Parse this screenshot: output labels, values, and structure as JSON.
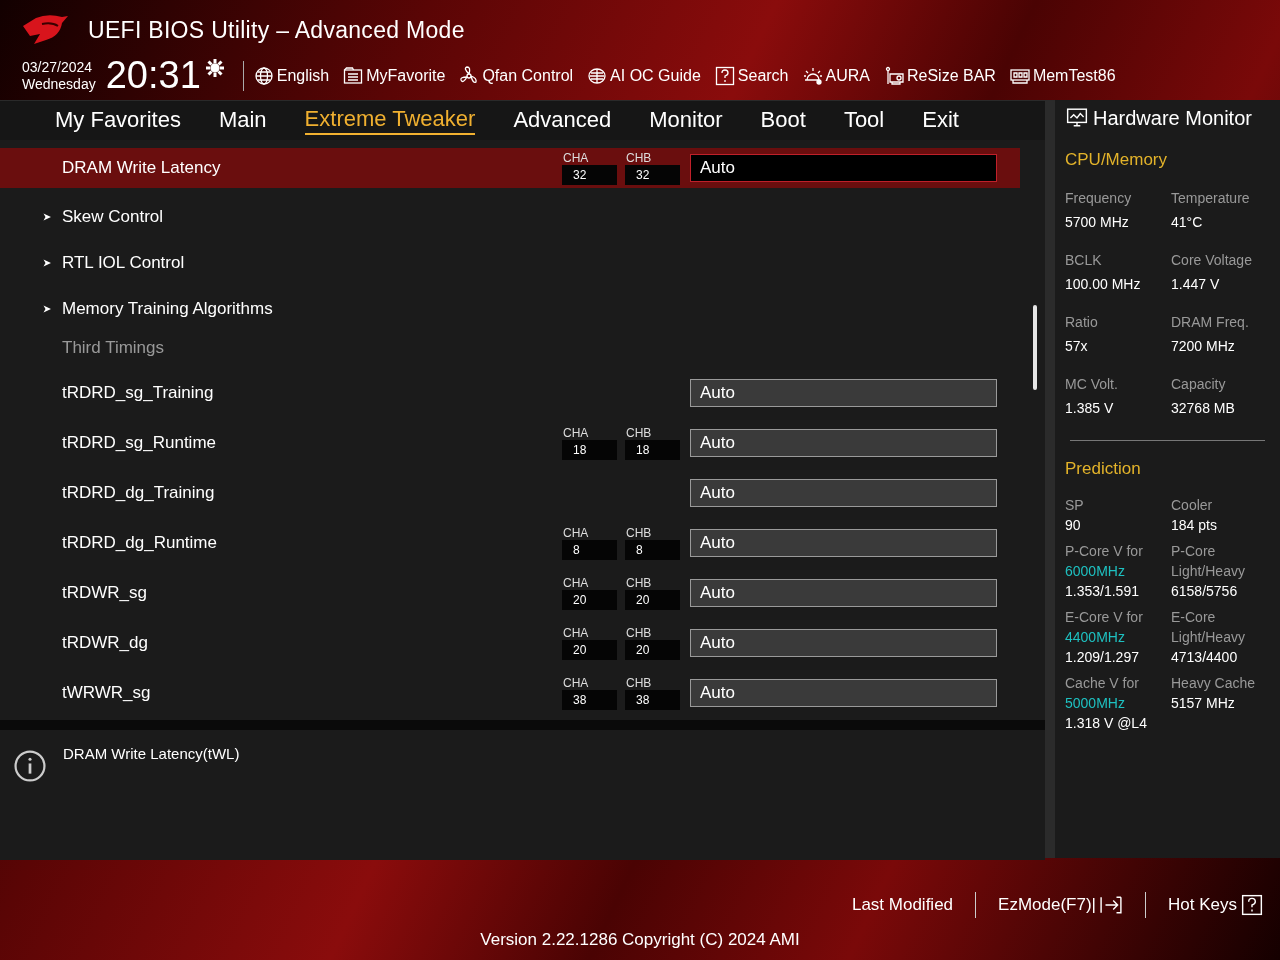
{
  "window": {
    "title": "UEFI BIOS Utility – Advanced Mode"
  },
  "clock": {
    "date": "03/27/2024",
    "day": "Wednesday",
    "time": "20:31"
  },
  "toolbar": [
    {
      "label": "English"
    },
    {
      "label": "MyFavorite"
    },
    {
      "label": "Qfan Control"
    },
    {
      "label": "AI OC Guide"
    },
    {
      "label": "Search"
    },
    {
      "label": "AURA"
    },
    {
      "label": "ReSize BAR"
    },
    {
      "label": "MemTest86"
    }
  ],
  "tabs": [
    {
      "label": "My Favorites",
      "selected": false
    },
    {
      "label": "Main",
      "selected": false
    },
    {
      "label": "Extreme Tweaker",
      "selected": true
    },
    {
      "label": "Advanced",
      "selected": false
    },
    {
      "label": "Monitor",
      "selected": false
    },
    {
      "label": "Boot",
      "selected": false
    },
    {
      "label": "Tool",
      "selected": false
    },
    {
      "label": "Exit",
      "selected": false
    }
  ],
  "settings": [
    {
      "kind": "setting",
      "label": "DRAM Write Latency",
      "selected": true,
      "channels": [
        {
          "name": "CHA",
          "value": "32"
        },
        {
          "name": "CHB",
          "value": "32"
        }
      ],
      "value": "Auto"
    },
    {
      "kind": "submenu",
      "label": "Skew Control"
    },
    {
      "kind": "submenu",
      "label": "RTL IOL Control"
    },
    {
      "kind": "submenu",
      "label": "Memory Training Algorithms"
    },
    {
      "kind": "heading",
      "label": "Third Timings"
    },
    {
      "kind": "setting",
      "label": "tRDRD_sg_Training",
      "selected": false,
      "value": "Auto"
    },
    {
      "kind": "setting",
      "label": "tRDRD_sg_Runtime",
      "selected": false,
      "channels": [
        {
          "name": "CHA",
          "value": "18"
        },
        {
          "name": "CHB",
          "value": "18"
        }
      ],
      "value": "Auto"
    },
    {
      "kind": "setting",
      "label": "tRDRD_dg_Training",
      "selected": false,
      "value": "Auto"
    },
    {
      "kind": "setting",
      "label": "tRDRD_dg_Runtime",
      "selected": false,
      "channels": [
        {
          "name": "CHA",
          "value": "8"
        },
        {
          "name": "CHB",
          "value": "8"
        }
      ],
      "value": "Auto"
    },
    {
      "kind": "setting",
      "label": "tRDWR_sg",
      "selected": false,
      "channels": [
        {
          "name": "CHA",
          "value": "20"
        },
        {
          "name": "CHB",
          "value": "20"
        }
      ],
      "value": "Auto"
    },
    {
      "kind": "setting",
      "label": "tRDWR_dg",
      "selected": false,
      "channels": [
        {
          "name": "CHA",
          "value": "20"
        },
        {
          "name": "CHB",
          "value": "20"
        }
      ],
      "value": "Auto"
    },
    {
      "kind": "setting",
      "label": "tWRWR_sg",
      "selected": false,
      "channels": [
        {
          "name": "CHA",
          "value": "38"
        },
        {
          "name": "CHB",
          "value": "38"
        }
      ],
      "value": "Auto"
    }
  ],
  "help": {
    "text": "DRAM Write Latency(tWL)"
  },
  "hardware_monitor": {
    "title": "Hardware Monitor",
    "sections": [
      {
        "title": "CPU/Memory",
        "items": [
          {
            "label": "Frequency",
            "value": "5700 MHz"
          },
          {
            "label": "Temperature",
            "value": "41°C"
          },
          {
            "label": "BCLK",
            "value": "100.00 MHz"
          },
          {
            "label": "Core Voltage",
            "value": "1.447 V"
          },
          {
            "label": "Ratio",
            "value": "57x"
          },
          {
            "label": "DRAM Freq.",
            "value": "7200 MHz"
          },
          {
            "label": "MC Volt.",
            "value": "1.385 V"
          },
          {
            "label": "Capacity",
            "value": "32768 MB"
          }
        ]
      },
      {
        "title": "Prediction",
        "items": [
          {
            "label": "SP",
            "value": "90"
          },
          {
            "label": "Cooler",
            "value": "184 pts"
          },
          {
            "label": "P-Core V for",
            "highlight": "6000MHz",
            "value": "1.353/1.591"
          },
          {
            "label": "P-Core Light/Heavy",
            "value": "6158/5756"
          },
          {
            "label": "E-Core V for",
            "highlight": "4400MHz",
            "value": "1.209/1.297"
          },
          {
            "label": "E-Core Light/Heavy",
            "value": "4713/4400"
          },
          {
            "label": "Cache V for",
            "highlight": "5000MHz",
            "value": "1.318 V @L4"
          },
          {
            "label": "Heavy Cache",
            "value": "5157 MHz"
          }
        ]
      }
    ]
  },
  "footer": {
    "actions": [
      {
        "label": "Last Modified"
      },
      {
        "label": "EzMode(F7)|"
      },
      {
        "label": "Hot Keys"
      }
    ],
    "version": "Version 2.22.1286 Copyright (C) 2024 AMI"
  }
}
